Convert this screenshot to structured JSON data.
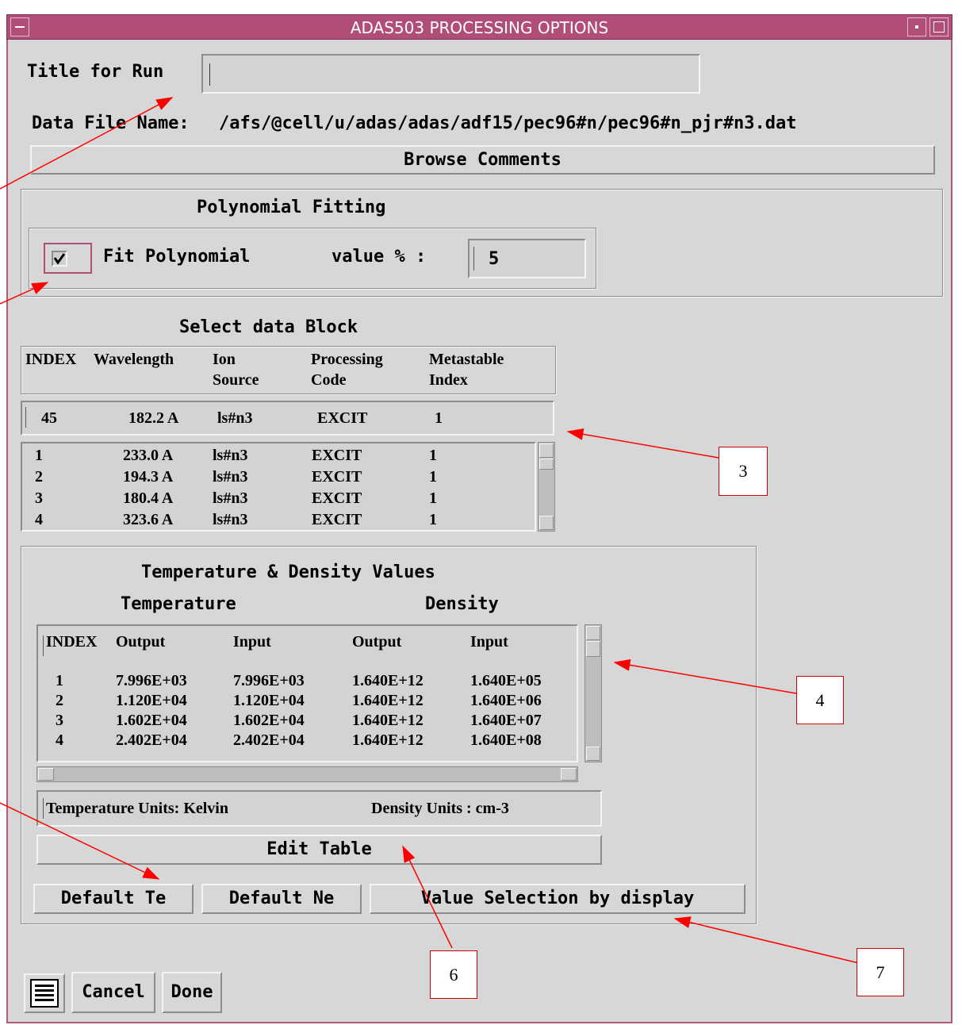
{
  "window": {
    "title": "ADAS503 PROCESSING OPTIONS"
  },
  "run_title": {
    "label": "Title for Run",
    "value": ""
  },
  "data_file": {
    "label": "Data File Name:",
    "path": "/afs/@cell/u/adas/adas/adf15/pec96#n/pec96#n_pjr#n3.dat"
  },
  "browse_button": "Browse Comments",
  "polynomial": {
    "heading": "Polynomial Fitting",
    "checkbox_label": "Fit Polynomial",
    "checked": true,
    "value_label": "value % :",
    "value": "5"
  },
  "data_block": {
    "heading": "Select data Block",
    "headers": [
      [
        "INDEX",
        ""
      ],
      [
        "Wavelength",
        ""
      ],
      [
        "Ion",
        "Source"
      ],
      [
        "Processing",
        "Code"
      ],
      [
        "Metastable",
        "Index"
      ]
    ],
    "selected": [
      "45",
      "182.2 A",
      "ls#n3",
      "EXCIT",
      "1"
    ],
    "rows": [
      [
        "1",
        "233.0 A",
        "ls#n3",
        "EXCIT",
        "1"
      ],
      [
        "2",
        "194.3 A",
        "ls#n3",
        "EXCIT",
        "1"
      ],
      [
        "3",
        "180.4 A",
        "ls#n3",
        "EXCIT",
        "1"
      ],
      [
        "4",
        "323.6 A",
        "ls#n3",
        "EXCIT",
        "1"
      ]
    ]
  },
  "temp_density": {
    "heading": "Temperature & Density Values",
    "temp_label": "Temperature",
    "dens_label": "Density",
    "headers": [
      "INDEX",
      "Output",
      "Input",
      "Output",
      "Input"
    ],
    "rows": [
      [
        "1",
        "7.996E+03",
        "7.996E+03",
        "1.640E+12",
        "1.640E+05"
      ],
      [
        "2",
        "1.120E+04",
        "1.120E+04",
        "1.640E+12",
        "1.640E+06"
      ],
      [
        "3",
        "1.602E+04",
        "1.602E+04",
        "1.640E+12",
        "1.640E+07"
      ],
      [
        "4",
        "2.402E+04",
        "2.402E+04",
        "1.640E+12",
        "1.640E+08"
      ]
    ],
    "temp_units": "Temperature Units: Kelvin",
    "dens_units": "Density Units : cm-3",
    "edit_button": "Edit Table",
    "default_te": "Default Te",
    "default_ne": "Default Ne",
    "value_selection": "Value Selection by display"
  },
  "bottom": {
    "cancel": "Cancel",
    "done": "Done"
  },
  "callouts": {
    "c3": "3",
    "c4": "4",
    "c6": "6",
    "c7": "7"
  },
  "colors": {
    "titlebar": "#b04e79",
    "window_bg": "#d7d7d7",
    "annotation": "#ff0000"
  },
  "icons": [
    "window-menu-icon",
    "minimize-icon",
    "maximize-icon",
    "checkmark-icon",
    "list-icon",
    "scroll-up-icon",
    "scroll-down-icon",
    "scroll-left-icon",
    "scroll-right-icon"
  ]
}
